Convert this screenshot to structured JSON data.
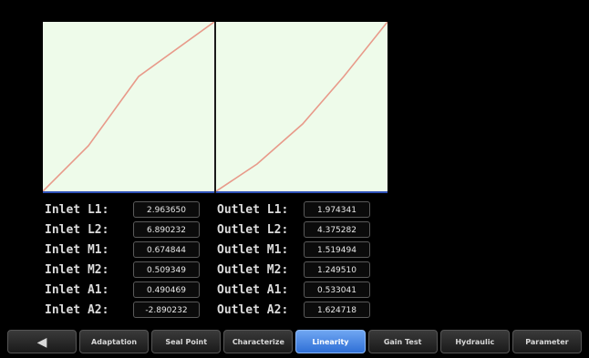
{
  "inlet": [
    {
      "label": "Inlet L1:",
      "value": "2.963650"
    },
    {
      "label": "Inlet L2:",
      "value": "6.890232"
    },
    {
      "label": "Inlet M1:",
      "value": "0.674844"
    },
    {
      "label": "Inlet M2:",
      "value": "0.509349"
    },
    {
      "label": "Inlet A1:",
      "value": "0.490469"
    },
    {
      "label": "Inlet A2:",
      "value": "-2.890232"
    }
  ],
  "outlet": [
    {
      "label": "Outlet L1:",
      "value": "1.974341"
    },
    {
      "label": "Outlet L2:",
      "value": "4.375282"
    },
    {
      "label": "Outlet M1:",
      "value": "1.519494"
    },
    {
      "label": "Outlet M2:",
      "value": "1.249510"
    },
    {
      "label": "Outlet A1:",
      "value": "0.533041"
    },
    {
      "label": "Outlet A2:",
      "value": "1.624718"
    }
  ],
  "tabs": [
    {
      "label": "◀",
      "icon": "back-arrow-icon"
    },
    {
      "label": "Adaptation"
    },
    {
      "label": "Seal Point"
    },
    {
      "label": "Characterize"
    },
    {
      "label": "Linearity",
      "active": true
    },
    {
      "label": "Gain Test"
    },
    {
      "label": "Hydraulic"
    },
    {
      "label": "Parameter"
    }
  ],
  "colors": {
    "plot_background": "#eefbea",
    "curve": "#e89a8a",
    "plot_baseline": "#2f52b8",
    "active_tab": "#3f82e6"
  }
}
